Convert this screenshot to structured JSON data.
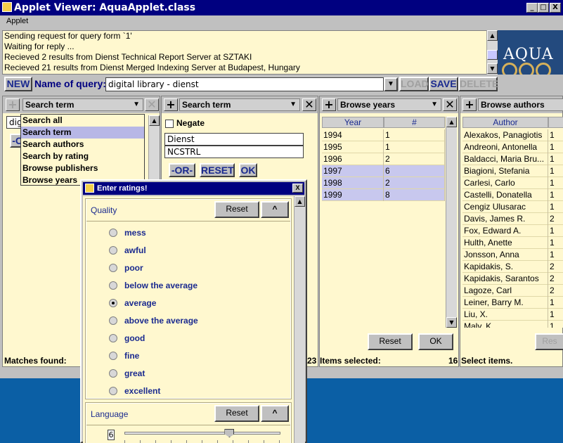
{
  "window": {
    "title": "Applet Viewer: AquaApplet.class",
    "menu": "Applet",
    "min": "_",
    "max": "□",
    "close": "X"
  },
  "log": {
    "lines": [
      "Sending request for query form `1'",
      "Waiting for reply ...",
      "Recieved 2 results from Dienst Technical Report Server at SZTAKI",
      "Recieved 21 results from Dienst Merged Indexing Server at Budapest, Hungary"
    ]
  },
  "logo": {
    "text": "AQUA"
  },
  "query": {
    "new_label": "NEW",
    "name_label": "Name of query:",
    "value": "digital library - dienst",
    "load_label": "LOAD",
    "save_label": "SAVE",
    "delete_label": "DELETE"
  },
  "panel1": {
    "combo": "Search term",
    "input_value": "dig",
    "button_partial": "-O",
    "matches": "Matches found:",
    "dropdown": [
      "Search all",
      "Search term",
      "Search authors",
      "Search by rating",
      "Browse publishers",
      "Browse years"
    ],
    "dropdown_selected": 1
  },
  "panel2": {
    "combo": "Search term",
    "negate": "Negate",
    "terms": [
      "Dienst",
      "NCSTRL"
    ],
    "or_label": "-OR-",
    "reset_label": "RESET",
    "ok_label": "OK",
    "count": "23"
  },
  "panel3": {
    "combo": "Browse years",
    "headers": [
      "Year",
      "#"
    ],
    "rows": [
      {
        "year": "1994",
        "count": "1",
        "hl": false
      },
      {
        "year": "1995",
        "count": "1",
        "hl": false
      },
      {
        "year": "1996",
        "count": "2",
        "hl": false
      },
      {
        "year": "1997",
        "count": "6",
        "hl": true
      },
      {
        "year": "1998",
        "count": "2",
        "hl": true
      },
      {
        "year": "1999",
        "count": "8",
        "hl": true
      }
    ],
    "reset_label": "Reset",
    "ok_label": "OK",
    "status": "Items selected:",
    "status_count": "16"
  },
  "panel4": {
    "combo": "Browse authors",
    "headers": [
      "Author"
    ],
    "rows": [
      {
        "name": "Alexakos, Panagiotis",
        "c": "1"
      },
      {
        "name": "Andreoni, Antonella",
        "c": "1"
      },
      {
        "name": "Baldacci, Maria Bru...",
        "c": "1"
      },
      {
        "name": "Biagioni, Stefania",
        "c": "1"
      },
      {
        "name": "Carlesi, Carlo",
        "c": "1"
      },
      {
        "name": "Castelli, Donatella",
        "c": "1"
      },
      {
        "name": "Cengiz Ulusarac",
        "c": "1"
      },
      {
        "name": "Davis, James R.",
        "c": "2"
      },
      {
        "name": "Fox, Edward A.",
        "c": "1"
      },
      {
        "name": "Hulth, Anette",
        "c": "1"
      },
      {
        "name": "Jonsson, Anna",
        "c": "1"
      },
      {
        "name": "Kapidakis, S.",
        "c": "2"
      },
      {
        "name": "Kapidakis, Sarantos",
        "c": "2"
      },
      {
        "name": "Lagoze, Carl",
        "c": "2"
      },
      {
        "name": "Leiner, Barry M.",
        "c": "1"
      },
      {
        "name": "Liu, X.",
        "c": "1"
      },
      {
        "name": "Maly, K.",
        "c": "1"
      }
    ],
    "reset_label": "Res",
    "status": "Select items."
  },
  "dialog": {
    "title": "Enter ratings!",
    "quality_label": "Quality",
    "reset_label": "Reset",
    "collapse_label": "^",
    "options": [
      "mess",
      "awful",
      "poor",
      "below the average",
      "average",
      "above the average",
      "good",
      "fine",
      "great",
      "excellent"
    ],
    "selected": 4,
    "language_label": "Language",
    "language_value": "6",
    "slider_fraction": 0.68
  }
}
